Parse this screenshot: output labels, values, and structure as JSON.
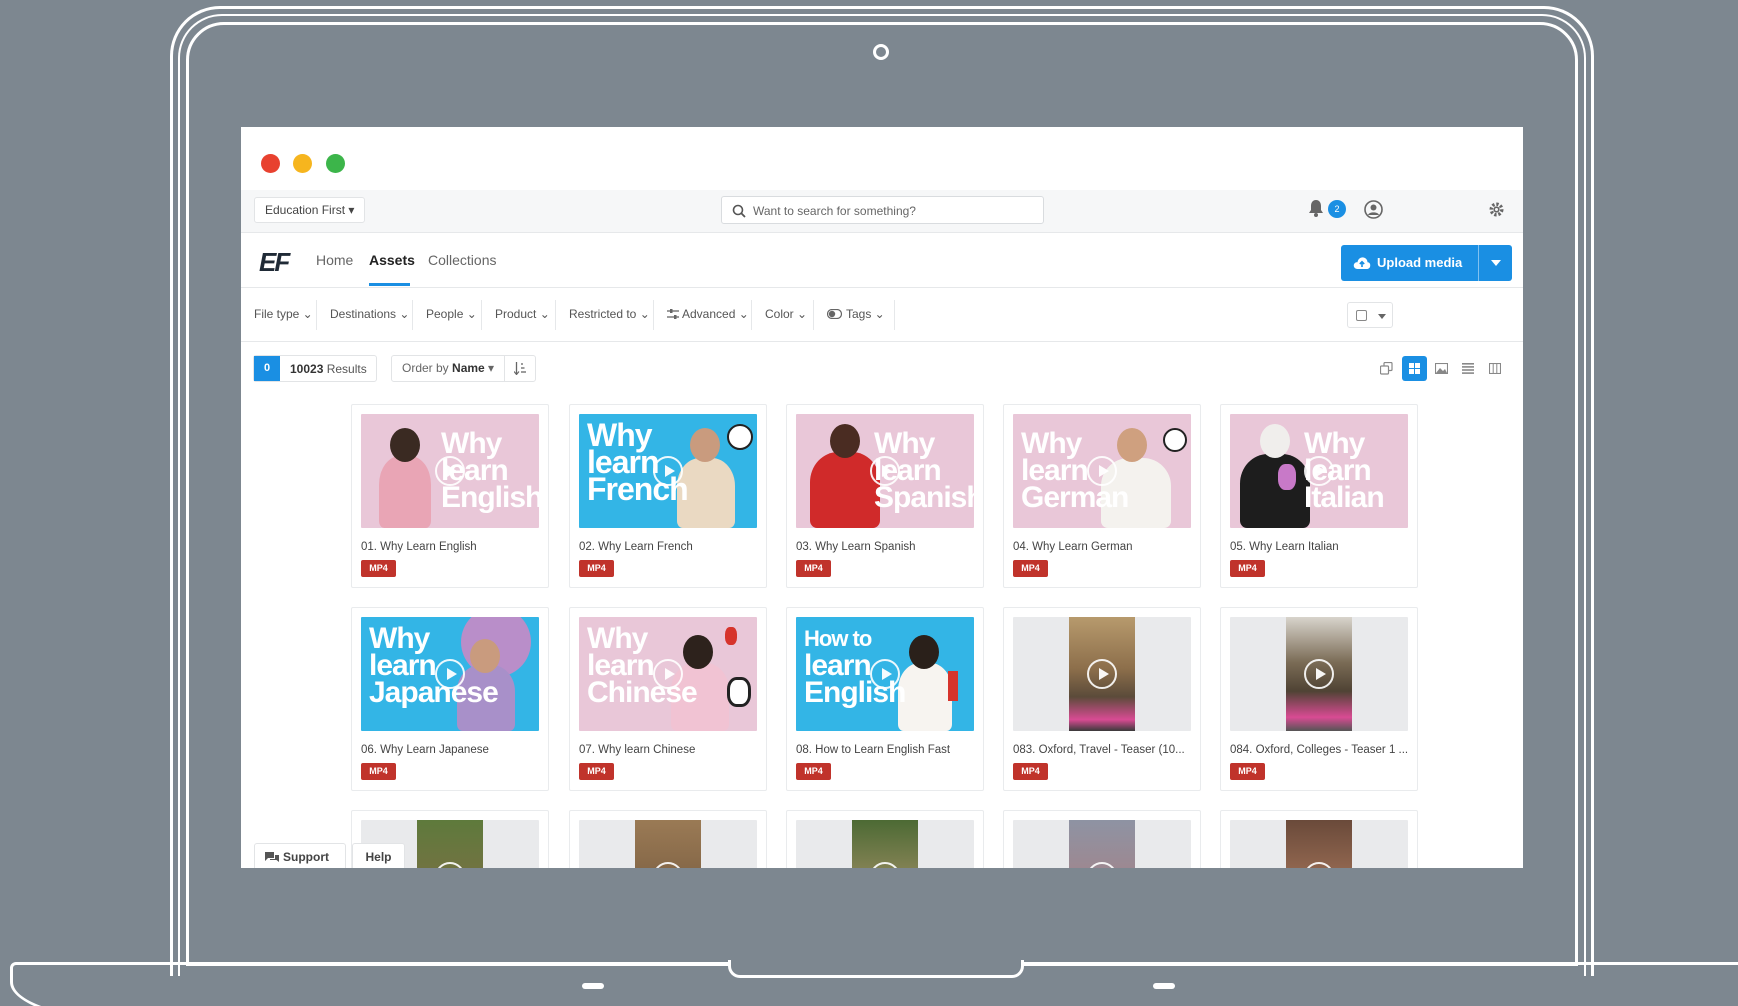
{
  "org_selector": "Education First ▾",
  "search": {
    "placeholder": "Want to search for something?"
  },
  "notifications": {
    "count": "2"
  },
  "logo": "EF",
  "nav": {
    "home": "Home",
    "assets": "Assets",
    "collections": "Collections"
  },
  "upload": {
    "label": "Upload media"
  },
  "filters": [
    {
      "label": "File type ⌄"
    },
    {
      "label": "Destinations ⌄"
    },
    {
      "label": "People ⌄"
    },
    {
      "label": "Product ⌄"
    },
    {
      "label": "Restricted to ⌄"
    },
    {
      "label": "Advanced ⌄"
    },
    {
      "label": "Color ⌄"
    },
    {
      "label": "Tags ⌄"
    }
  ],
  "results": {
    "selected": "0",
    "count": "10023",
    "suffix": "Results"
  },
  "order": {
    "prefix": "Order by",
    "field": "Name"
  },
  "assets": [
    {
      "title": "01. Why Learn English",
      "type": "MP4",
      "thumb_text": [
        "Why",
        "learn",
        "English"
      ],
      "bg": "#e9c7d8"
    },
    {
      "title": "02. Why Learn French",
      "type": "MP4",
      "thumb_text": [
        "Why",
        "learn",
        "French"
      ],
      "bg": "#33b5e6"
    },
    {
      "title": "03. Why Learn Spanish",
      "type": "MP4",
      "thumb_text": [
        "Why",
        "learn",
        "Spanish"
      ],
      "bg": "#e9c7d8"
    },
    {
      "title": "04. Why Learn German",
      "type": "MP4",
      "thumb_text": [
        "Why",
        "learn",
        "German"
      ],
      "bg": "#e9c7d8"
    },
    {
      "title": "05. Why Learn Italian",
      "type": "MP4",
      "thumb_text": [
        "Why",
        "learn",
        "Italian"
      ],
      "bg": "#e9c7d8"
    },
    {
      "title": "06. Why Learn Japanese",
      "type": "MP4",
      "thumb_text": [
        "Why",
        "learn",
        "Japanese"
      ],
      "bg": "#33b5e6"
    },
    {
      "title": "07. Why learn Chinese",
      "type": "MP4",
      "thumb_text": [
        "Why",
        "learn",
        "Chinese"
      ],
      "bg": "#e9c7d8"
    },
    {
      "title": "08. How to Learn English Fast",
      "type": "MP4",
      "thumb_text": [
        "How to",
        "learn",
        "English"
      ],
      "bg": "#33b5e6"
    },
    {
      "title": "083. Oxford, Travel - Teaser (10...",
      "type": "MP4",
      "thumb_text": [],
      "bg": "#e9eaec"
    },
    {
      "title": "084. Oxford, Colleges - Teaser 1 ...",
      "type": "MP4",
      "thumb_text": [],
      "bg": "#e9eaec"
    }
  ],
  "support": {
    "label": "Support"
  },
  "help": {
    "label": "Help"
  },
  "colors": {
    "accent": "#1a8fe3",
    "mp4_badge": "#c0332b",
    "close": "#e8412f",
    "minimize": "#f6b51e",
    "zoom": "#3cb54a"
  }
}
